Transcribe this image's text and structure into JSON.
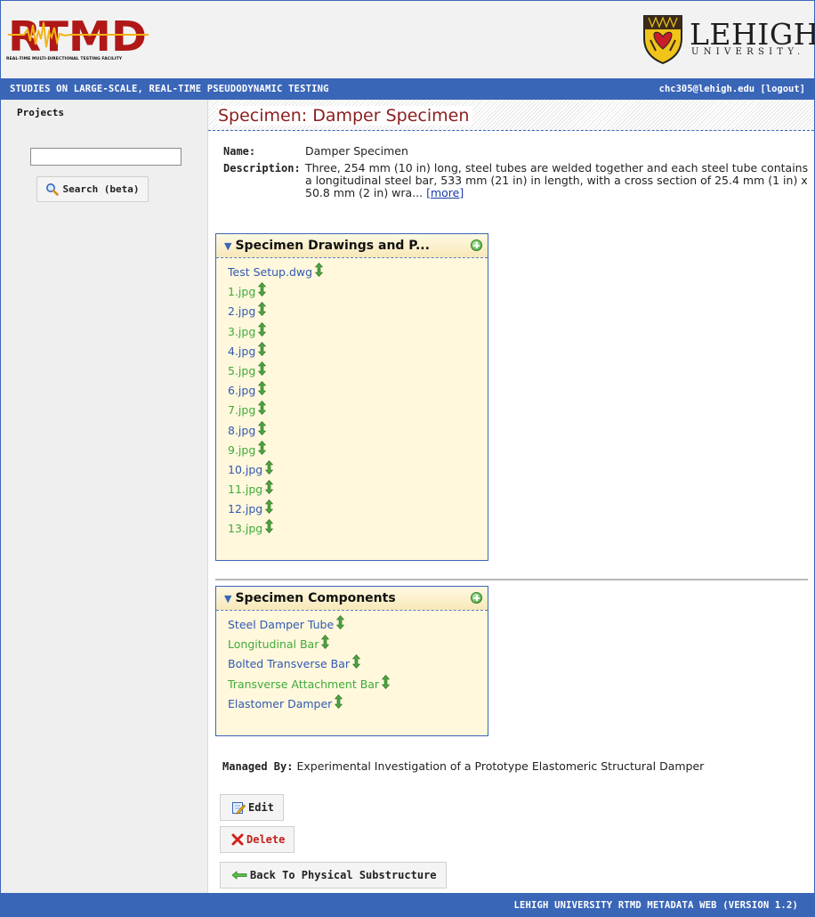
{
  "header": {
    "rtmd_logo_text": "RTMD",
    "rtmd_subtitle": "REAL-TIME MULTI-DIRECTIONAL TESTING FACILITY",
    "university_name": "LEHIGH",
    "university_sub": "UNIVERSITY."
  },
  "title_bar": {
    "site_title": "STUDIES ON LARGE-SCALE, REAL-TIME PSEUDODYNAMIC TESTING",
    "user_email": "chc305@lehigh.edu",
    "logout_label": "[logout]"
  },
  "sidebar": {
    "heading": "Projects",
    "search_value": "",
    "search_button": "Search (beta)"
  },
  "main": {
    "page_title": "Specimen: Damper Specimen",
    "name_label": "Name:",
    "name_value": "Damper Specimen",
    "description_label": "Description:",
    "description_value": "Three, 254 mm (10 in) long, steel tubes are welded together and each steel tube contains a longitudinal steel bar, 533 mm (21 in) in length, with a cross section of 25.4 mm (1 in) x 50.8 mm (2 in) wra...",
    "more_link": "[more]",
    "drawings_panel": {
      "title": "Specimen Drawings and P...",
      "items": [
        {
          "label": "Test Setup.dwg",
          "color": "#3158b3"
        },
        {
          "label": "1.jpg",
          "color": "#3faa3a"
        },
        {
          "label": "2.jpg",
          "color": "#3158b3"
        },
        {
          "label": "3.jpg",
          "color": "#3faa3a"
        },
        {
          "label": "4.jpg",
          "color": "#3158b3"
        },
        {
          "label": "5.jpg",
          "color": "#3faa3a"
        },
        {
          "label": "6.jpg",
          "color": "#3158b3"
        },
        {
          "label": "7.jpg",
          "color": "#3faa3a"
        },
        {
          "label": "8.jpg",
          "color": "#3158b3"
        },
        {
          "label": "9.jpg",
          "color": "#3faa3a"
        },
        {
          "label": "10.jpg",
          "color": "#3158b3"
        },
        {
          "label": "11.jpg",
          "color": "#3faa3a"
        },
        {
          "label": "12.jpg",
          "color": "#3158b3"
        },
        {
          "label": "13.jpg",
          "color": "#3faa3a"
        }
      ]
    },
    "components_panel": {
      "title": "Specimen Components",
      "items": [
        {
          "label": "Steel Damper Tube",
          "color": "#3158b3"
        },
        {
          "label": "Longitudinal Bar",
          "color": "#3faa3a"
        },
        {
          "label": "Bolted Transverse Bar",
          "color": "#3158b3"
        },
        {
          "label": "Transverse Attachment Bar",
          "color": "#3faa3a"
        },
        {
          "label": "Elastomer Damper",
          "color": "#3158b3"
        }
      ]
    },
    "managed_by_label": "Managed By:",
    "managed_by_value": "Experimental Investigation of a Prototype Elastomeric Structural Damper",
    "edit_button": "Edit",
    "delete_button": "Delete",
    "back_button": "Back To Physical Substructure"
  },
  "footer": {
    "text": "LEHIGH UNIVERSITY RTMD METADATA WEB (VERSION 1.2)"
  },
  "colors": {
    "brand_blue": "#3a66b8",
    "title_red": "#8b1d1d",
    "panel_bg": "#fff8dc",
    "link_blue": "#3158b3",
    "link_green": "#3faa3a",
    "delete_red": "#c2201c"
  },
  "icons": {
    "add": "add-circle-icon",
    "reorder": "up-down-arrow-icon",
    "search": "magnifier-icon",
    "edit": "edit-pencil-icon",
    "delete": "red-x-icon",
    "back": "green-left-arrow-icon"
  }
}
